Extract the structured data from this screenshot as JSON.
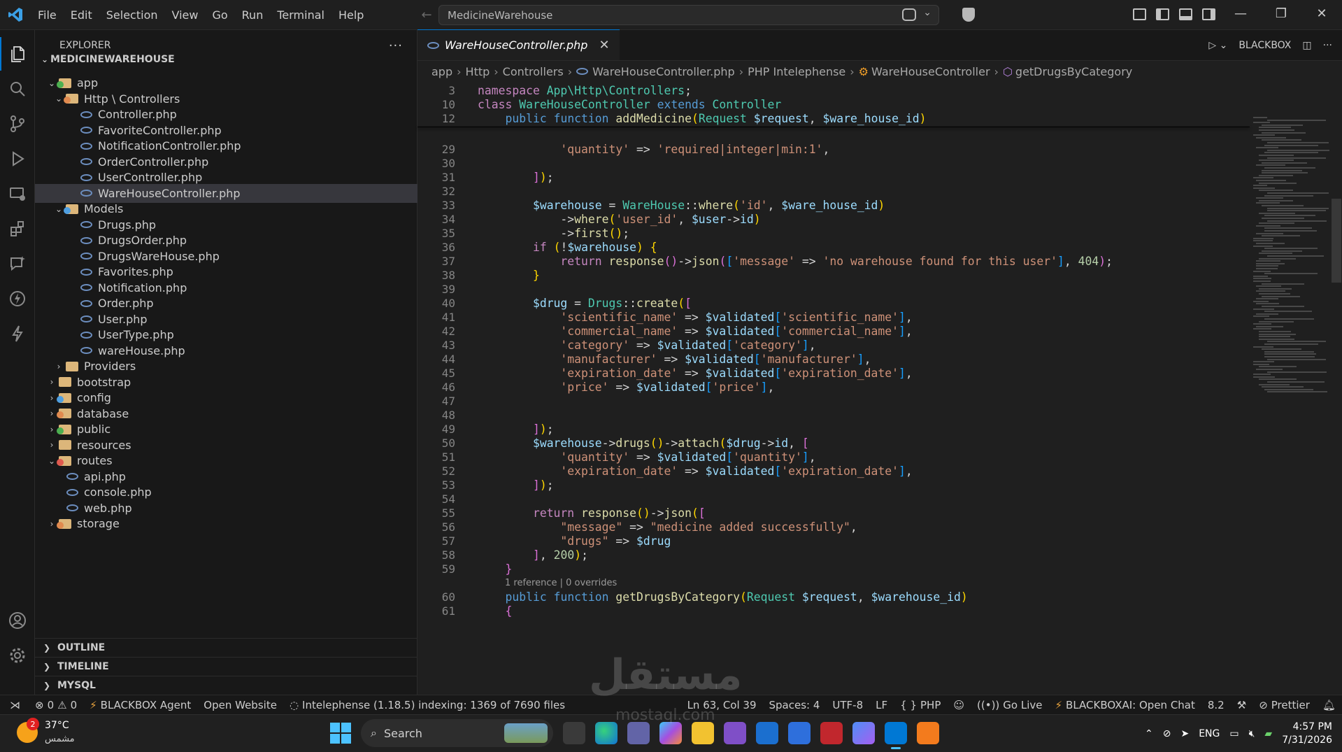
{
  "titlebar": {
    "menu": [
      "File",
      "Edit",
      "Selection",
      "View",
      "Go",
      "Run",
      "Terminal",
      "Help"
    ],
    "command_center": "MedicineWarehouse"
  },
  "explorer": {
    "title": "EXPLORER",
    "root": "MEDICINEWAREHOUSE",
    "tree": [
      {
        "label": "app",
        "depth": 1,
        "type": "folder",
        "open": true,
        "color": "green"
      },
      {
        "label": "Http \\ Controllers",
        "depth": 2,
        "type": "folder",
        "open": true,
        "color": "orange"
      },
      {
        "label": "Controller.php",
        "depth": 3,
        "type": "php"
      },
      {
        "label": "FavoriteController.php",
        "depth": 3,
        "type": "php"
      },
      {
        "label": "NotificationController.php",
        "depth": 3,
        "type": "php"
      },
      {
        "label": "OrderController.php",
        "depth": 3,
        "type": "php"
      },
      {
        "label": "UserController.php",
        "depth": 3,
        "type": "php"
      },
      {
        "label": "WareHouseController.php",
        "depth": 3,
        "type": "php",
        "selected": true
      },
      {
        "label": "Models",
        "depth": 2,
        "type": "folder",
        "open": true,
        "color": "blue"
      },
      {
        "label": "Drugs.php",
        "depth": 3,
        "type": "php"
      },
      {
        "label": "DrugsOrder.php",
        "depth": 3,
        "type": "php"
      },
      {
        "label": "DrugsWareHouse.php",
        "depth": 3,
        "type": "php"
      },
      {
        "label": "Favorites.php",
        "depth": 3,
        "type": "php"
      },
      {
        "label": "Notification.php",
        "depth": 3,
        "type": "php"
      },
      {
        "label": "Order.php",
        "depth": 3,
        "type": "php"
      },
      {
        "label": "User.php",
        "depth": 3,
        "type": "php"
      },
      {
        "label": "UserType.php",
        "depth": 3,
        "type": "php"
      },
      {
        "label": "wareHouse.php",
        "depth": 3,
        "type": "php"
      },
      {
        "label": "Providers",
        "depth": 2,
        "type": "folder",
        "open": false,
        "color": "plain"
      },
      {
        "label": "bootstrap",
        "depth": 1,
        "type": "folder",
        "open": false,
        "color": "plain"
      },
      {
        "label": "config",
        "depth": 1,
        "type": "folder",
        "open": false,
        "color": "blue"
      },
      {
        "label": "database",
        "depth": 1,
        "type": "folder",
        "open": false,
        "color": "orange"
      },
      {
        "label": "public",
        "depth": 1,
        "type": "folder",
        "open": false,
        "color": "green"
      },
      {
        "label": "resources",
        "depth": 1,
        "type": "folder",
        "open": false,
        "color": "plain"
      },
      {
        "label": "routes",
        "depth": 1,
        "type": "folder",
        "open": true,
        "color": "red"
      },
      {
        "label": "api.php",
        "depth": 2,
        "type": "php"
      },
      {
        "label": "console.php",
        "depth": 2,
        "type": "php"
      },
      {
        "label": "web.php",
        "depth": 2,
        "type": "php"
      },
      {
        "label": "storage",
        "depth": 1,
        "type": "folder",
        "open": false,
        "color": "orange"
      }
    ],
    "sections": [
      "OUTLINE",
      "TIMELINE",
      "MYSQL"
    ]
  },
  "editor": {
    "tab_label": "WareHouseController.php",
    "run_label": "BLACKBOX",
    "breadcrumbs": [
      "app",
      "Http",
      "Controllers",
      "WareHouseController.php",
      "PHP Intelephense",
      "WareHouseController",
      "getDrugsByCategory"
    ],
    "codelens": "1 reference | 0 overrides",
    "sticky_lines": [
      3,
      10,
      12
    ],
    "lines": [
      29,
      30,
      31,
      32,
      33,
      34,
      35,
      36,
      37,
      38,
      39,
      40,
      41,
      42,
      43,
      44,
      45,
      46,
      47,
      48,
      49,
      50,
      51,
      52,
      53,
      54,
      55,
      56,
      57,
      58,
      59,
      60,
      61
    ]
  },
  "statusbar": {
    "errors": "0",
    "warnings": "0",
    "blackbox_agent": "BLACKBOX Agent",
    "open_website": "Open Website",
    "indexing": "Intelephense (1.18.5) indexing: 1369 of 7690 files",
    "position": "Ln 63, Col 39",
    "spaces": "Spaces: 4",
    "encoding": "UTF-8",
    "eol": "LF",
    "language": "PHP",
    "go_live": "Go Live",
    "blackbox_chat": "BLACKBOXAI: Open Chat",
    "php_version": "8.2",
    "prettier": "Prettier"
  },
  "taskbar": {
    "weather_temp": "37°C",
    "weather_desc": "مشمس",
    "notification_count": "2",
    "search_label": "Search",
    "language": "ENG",
    "time": "4:57 PM",
    "date": "7/31/2026"
  },
  "watermark": {
    "text": "مستقل",
    "sub": "mostaql.com"
  }
}
